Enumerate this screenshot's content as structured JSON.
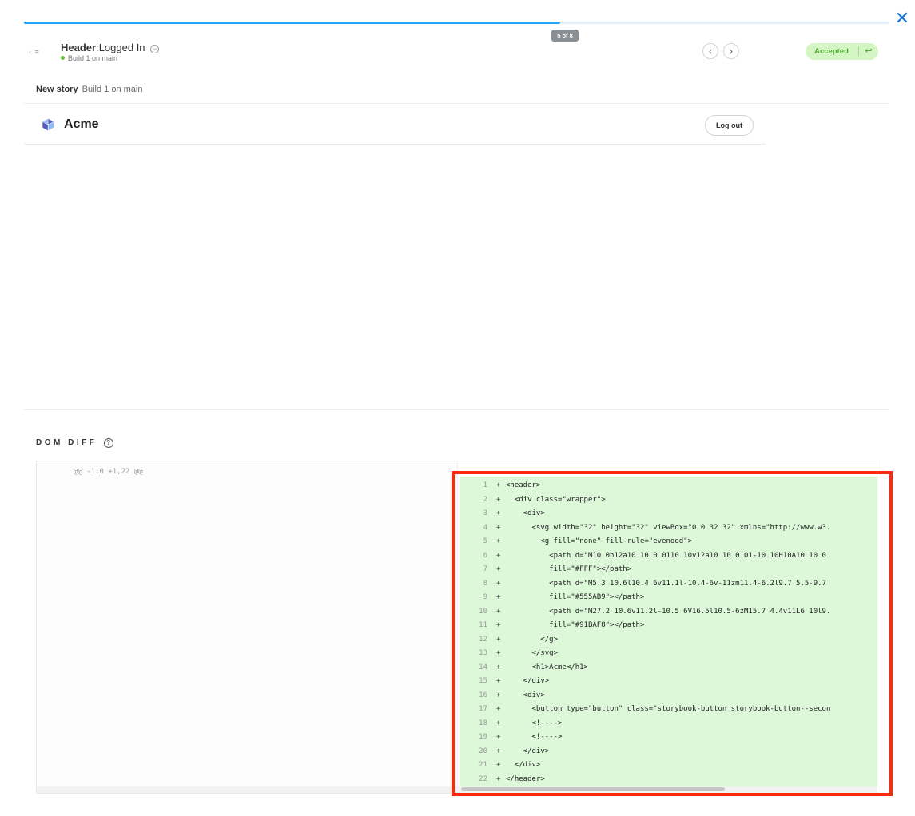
{
  "progress": {
    "fraction": 0.62,
    "badge": "5 of 8"
  },
  "story": {
    "component": "Header",
    "separator": ":",
    "name": "Logged In",
    "build": "Build 1 on main",
    "sidebar_toggle": "‹ ≡",
    "prev": "‹",
    "next": "›"
  },
  "review": {
    "status": "Accepted",
    "undo_icon": "undo-icon"
  },
  "canvas": {
    "new_story_label": "New story",
    "new_story_build": "Build 1 on main",
    "brand": "Acme",
    "logout": "Log out"
  },
  "dom_diff": {
    "heading": "DOM DIFF",
    "help": "?",
    "hunk": "@@ -1,0 +1,22 @@",
    "lines": [
      {
        "n": "1",
        "code": "<header>"
      },
      {
        "n": "2",
        "code": "  <div class=\"wrapper\">"
      },
      {
        "n": "3",
        "code": "    <div>"
      },
      {
        "n": "4",
        "code": "      <svg width=\"32\" height=\"32\" viewBox=\"0 0 32 32\" xmlns=\"http://www.w3."
      },
      {
        "n": "5",
        "code": "        <g fill=\"none\" fill-rule=\"evenodd\">"
      },
      {
        "n": "6",
        "code": "          <path d=\"M10 0h12a10 10 0 0110 10v12a10 10 0 01-10 10H10A10 10 0"
      },
      {
        "n": "7",
        "code": "          fill=\"#FFF\"></path>"
      },
      {
        "n": "8",
        "code": "          <path d=\"M5.3 10.6l10.4 6v11.1l-10.4-6v-11zm11.4-6.2l9.7 5.5-9.7"
      },
      {
        "n": "9",
        "code": "          fill=\"#555AB9\"></path>"
      },
      {
        "n": "10",
        "code": "          <path d=\"M27.2 10.6v11.2l-10.5 6V16.5l10.5-6zM15.7 4.4v11L6 10l9."
      },
      {
        "n": "11",
        "code": "          fill=\"#91BAF8\"></path>"
      },
      {
        "n": "12",
        "code": "        </g>"
      },
      {
        "n": "13",
        "code": "      </svg>"
      },
      {
        "n": "14",
        "code": "      <h1>Acme</h1>"
      },
      {
        "n": "15",
        "code": "    </div>"
      },
      {
        "n": "16",
        "code": "    <div>"
      },
      {
        "n": "17",
        "code": "      <button type=\"button\" class=\"storybook-button storybook-button--secon"
      },
      {
        "n": "18",
        "code": "      <!---->"
      },
      {
        "n": "19",
        "code": "      <!---->"
      },
      {
        "n": "20",
        "code": "    </div>"
      },
      {
        "n": "21",
        "code": "  </div>"
      },
      {
        "n": "22",
        "code": "</header>"
      }
    ]
  },
  "colors": {
    "progress": "#1ea7fd",
    "accepted_bg": "#d4f5c4",
    "accepted_text": "#4ea631",
    "diff_added_bg": "#dcf8d9",
    "highlight": "#ff2a0e",
    "close": "#1a74d8"
  }
}
